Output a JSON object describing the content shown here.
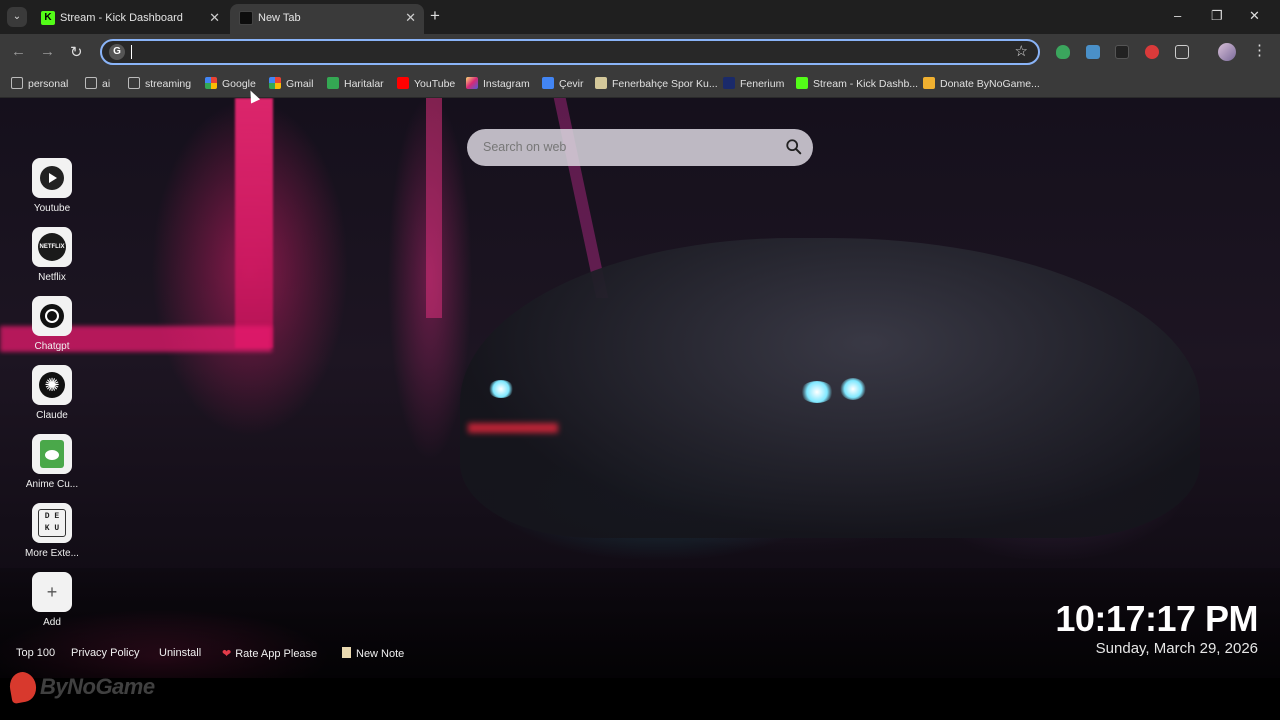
{
  "tabs": [
    {
      "title": "Stream - Kick Dashboard",
      "favicon": "kick-icon",
      "active": false
    },
    {
      "title": "New Tab",
      "favicon": "newtab-icon",
      "active": true
    }
  ],
  "window_controls": {
    "minimize": "–",
    "maximize": "❐",
    "close": "✕"
  },
  "address_bar": {
    "value": "",
    "placeholder": ""
  },
  "bookmarks": [
    {
      "label": "personal",
      "icon": "folder-icon"
    },
    {
      "label": "ai",
      "icon": "folder-icon"
    },
    {
      "label": "streaming",
      "icon": "folder-icon"
    },
    {
      "label": "Google",
      "icon": "google-icon"
    },
    {
      "label": "Gmail",
      "icon": "google-icon"
    },
    {
      "label": "Haritalar",
      "icon": "maps-icon"
    },
    {
      "label": "YouTube",
      "icon": "youtube-icon"
    },
    {
      "label": "Instagram",
      "icon": "instagram-icon"
    },
    {
      "label": "Çevir",
      "icon": "translate-icon"
    },
    {
      "label": "Fenerbahçe Spor Ku...",
      "icon": "fenerbahce-icon"
    },
    {
      "label": "Fenerium",
      "icon": "fenerium-icon"
    },
    {
      "label": "Stream - Kick Dashb...",
      "icon": "kick-icon"
    },
    {
      "label": "Donate ByNoGame...",
      "icon": "bynogame-icon"
    }
  ],
  "search": {
    "placeholder": "Search on web"
  },
  "shortcuts": [
    {
      "label": "Youtube",
      "icon": "youtube-icon"
    },
    {
      "label": "Netflix",
      "icon": "netflix-icon",
      "tile_text": "NETFLIX"
    },
    {
      "label": "Chatgpt",
      "icon": "chatgpt-icon"
    },
    {
      "label": "Claude",
      "icon": "claude-icon",
      "tile_text": "✺"
    },
    {
      "label": "Anime Cu...",
      "icon": "anime-icon"
    },
    {
      "label": "More Exte...",
      "icon": "dk-icon",
      "tile_text": "D E\nK U"
    },
    {
      "label": "Add",
      "icon": "plus-icon",
      "tile_text": "+"
    }
  ],
  "footer_links": {
    "top100": "Top 100",
    "privacy": "Privacy Policy",
    "uninstall": "Uninstall",
    "rate": "Rate App Please",
    "note": "New Note"
  },
  "clock": {
    "time": "10:17:17 PM",
    "date": "Sunday, March 29, 2026"
  },
  "watermark": {
    "text": "ByNoGame"
  },
  "colors": {
    "accent": "#8ab4f8",
    "kick": "#53fc18",
    "neon_pink": "#e81a6e"
  }
}
